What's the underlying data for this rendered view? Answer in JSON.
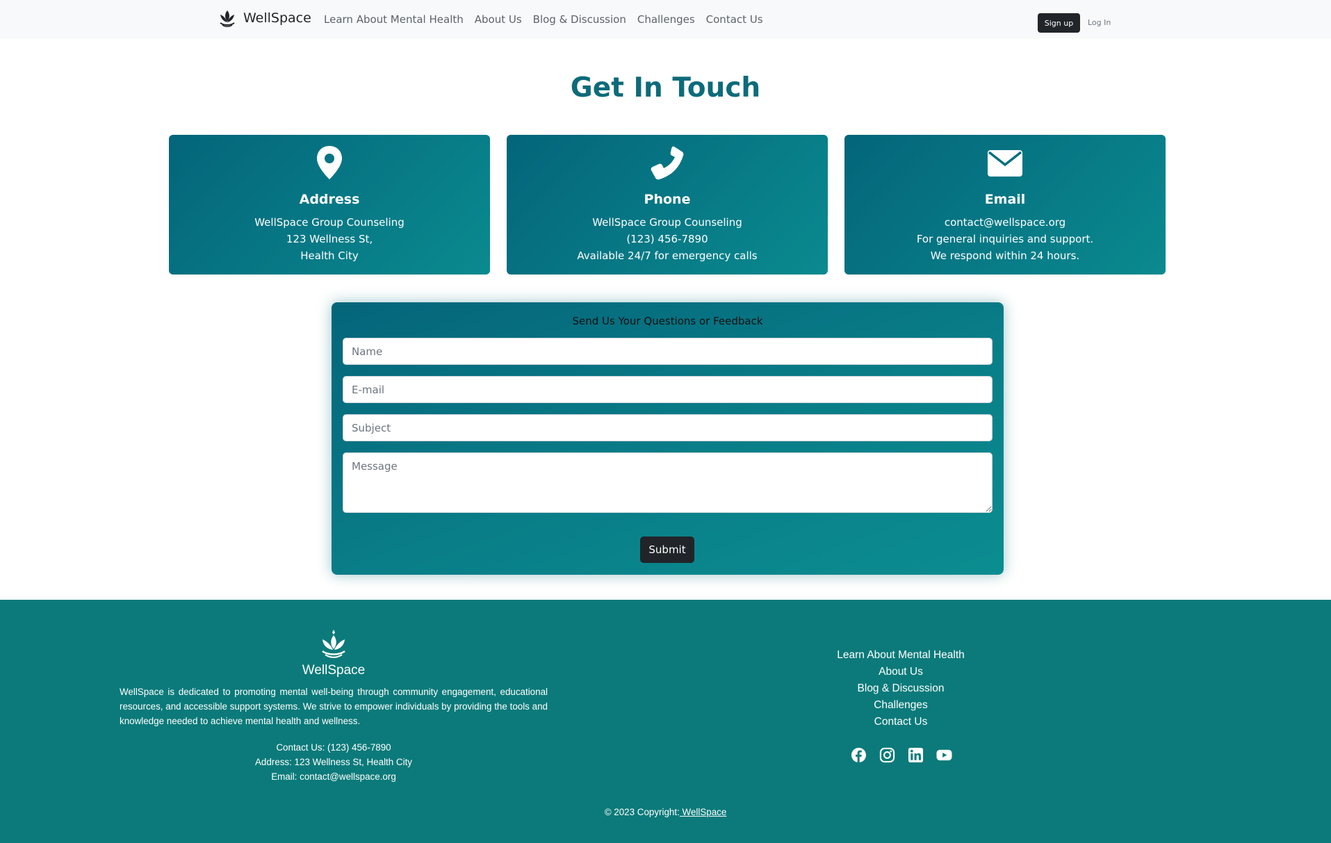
{
  "nav": {
    "brand": "WellSpace",
    "links": [
      "Learn About Mental Health",
      "About Us",
      "Blog & Discussion",
      "Challenges",
      "Contact Us"
    ],
    "signup_label": "Sign up",
    "login_label": "Log In"
  },
  "page_title": "Get In Touch",
  "cards": [
    {
      "icon": "map-pin-icon",
      "title": "Address",
      "lines": [
        "WellSpace Group Counseling",
        "123 Wellness St,",
        "Health City"
      ]
    },
    {
      "icon": "phone-icon",
      "title": "Phone",
      "lines": [
        "WellSpace Group Counseling",
        "(123) 456-7890",
        "Available 24/7 for emergency calls"
      ]
    },
    {
      "icon": "envelope-icon",
      "title": "Email",
      "lines": [
        "contact@wellspace.org",
        "For general inquiries and support.",
        "We respond within 24 hours."
      ]
    }
  ],
  "form": {
    "title": "Send Us Your Questions or Feedback",
    "name_placeholder": "Name",
    "email_placeholder": "E-mail",
    "subject_placeholder": "Subject",
    "message_placeholder": "Message",
    "submit_label": "Submit"
  },
  "footer": {
    "brand": "WellSpace",
    "description": "WellSpace is dedicated to promoting mental well-being through community engagement, educational resources, and accessible support systems. We strive to empower individuals by providing the tools and knowledge needed to achieve mental health and wellness.",
    "contact_phone": "Contact Us: (123) 456-7890",
    "contact_address": "Address: 123 Wellness St, Health City",
    "contact_email": "Email: contact@wellspace.org",
    "links": [
      "Learn About Mental Health",
      "About Us",
      "Blog & Discussion",
      "Challenges",
      "Contact Us"
    ],
    "social": [
      "facebook-icon",
      "instagram-icon",
      "linkedin-icon",
      "youtube-icon"
    ],
    "copyright": "© 2023 Copyright:",
    "copyright_link": " WellSpace"
  },
  "colors": {
    "teal_dark": "#04657a",
    "teal_light": "#0a8a8f",
    "footer_bg": "#0c7a7a",
    "title": "#0d6b7a",
    "dark_button": "#212529"
  }
}
